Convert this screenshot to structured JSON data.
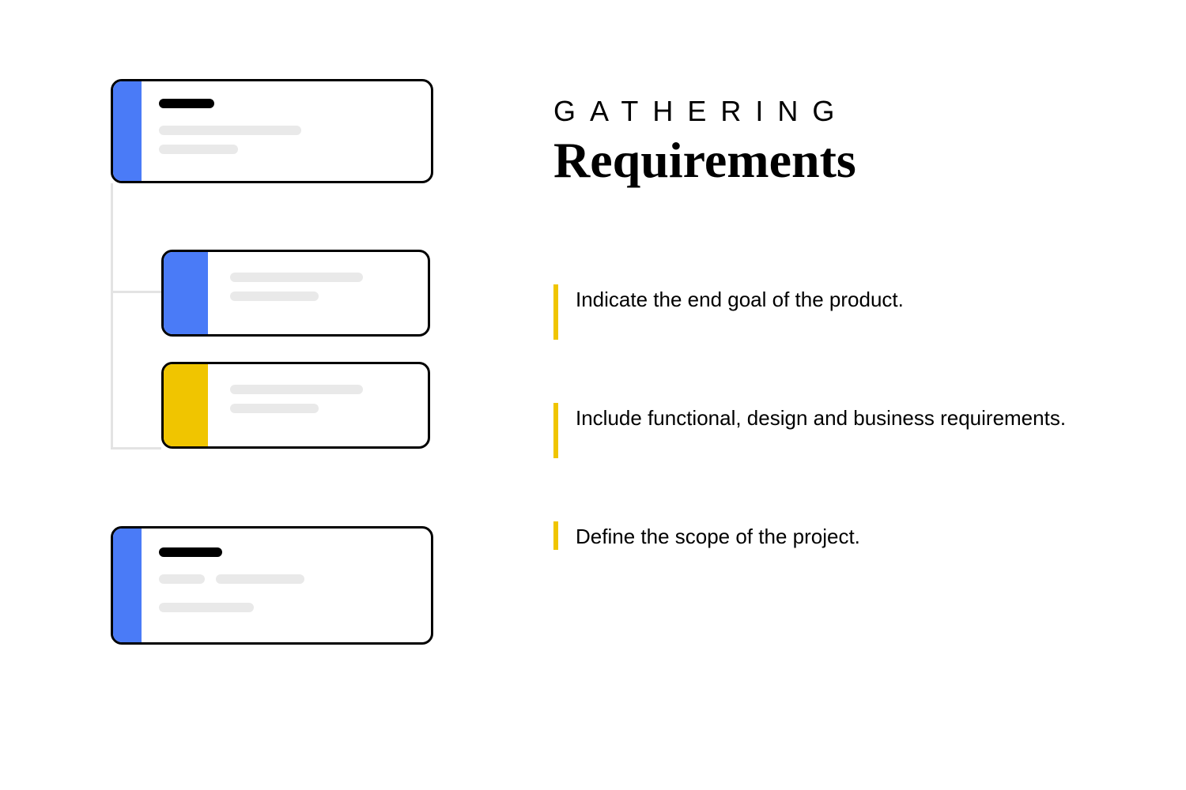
{
  "heading": {
    "eyebrow": "GATHERING",
    "title": "Requirements"
  },
  "bullets": [
    {
      "text": "Indicate the end goal of the product."
    },
    {
      "text": "Include functional, design and business requirements."
    },
    {
      "text": "Define the scope of the project."
    }
  ],
  "colors": {
    "accent_blue": "#4a7bf7",
    "accent_yellow": "#f0c500",
    "placeholder_grey": "#e9e9e9"
  },
  "diagram_cards": [
    {
      "id": 1,
      "accent": "blue",
      "type": "parent"
    },
    {
      "id": 2,
      "accent": "blue",
      "type": "child"
    },
    {
      "id": 3,
      "accent": "yellow",
      "type": "child"
    },
    {
      "id": 4,
      "accent": "blue",
      "type": "sibling"
    }
  ]
}
